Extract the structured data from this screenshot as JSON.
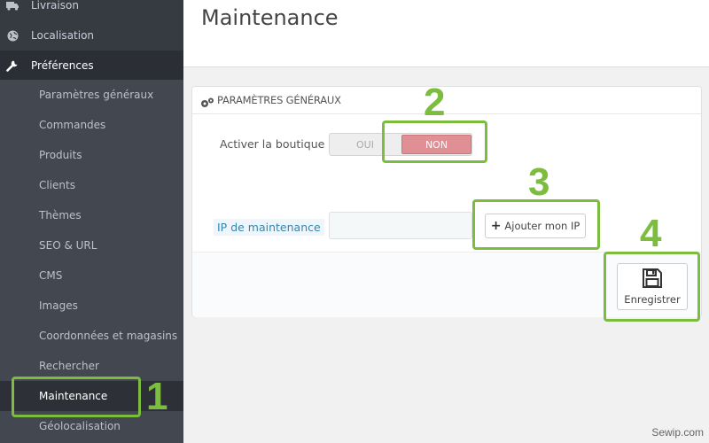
{
  "sidebar": {
    "top_items": [
      {
        "label": "Livraison",
        "icon": "truck-icon"
      },
      {
        "label": "Localisation",
        "icon": "globe-icon"
      },
      {
        "label": "Préférences",
        "icon": "wrench-icon"
      }
    ],
    "submenu": [
      "Paramètres généraux",
      "Commandes",
      "Produits",
      "Clients",
      "Thèmes",
      "SEO & URL",
      "CMS",
      "Images",
      "Coordonnées et magasins",
      "Rechercher",
      "Maintenance",
      "Géolocalisation"
    ]
  },
  "header": {
    "title": "Maintenance"
  },
  "panel": {
    "heading": "PARAMÈTRES GÉNÉRAUX",
    "shop_label": "Activer la boutique",
    "switch": {
      "yes": "OUI",
      "no": "NON",
      "selected": "NON"
    },
    "ip_label": "IP de maintenance",
    "ip_value": "",
    "add_ip_button": "Ajouter mon IP",
    "save_button": "Enregistrer"
  },
  "annotations": [
    "1",
    "2",
    "3",
    "4"
  ],
  "watermark": "Sewip.com",
  "colors": {
    "sidebar": "#363a41",
    "submenu": "#43474f",
    "active_off": "#e08f95",
    "annotation": "#7cbd3f",
    "label_link": "#3586ae"
  }
}
